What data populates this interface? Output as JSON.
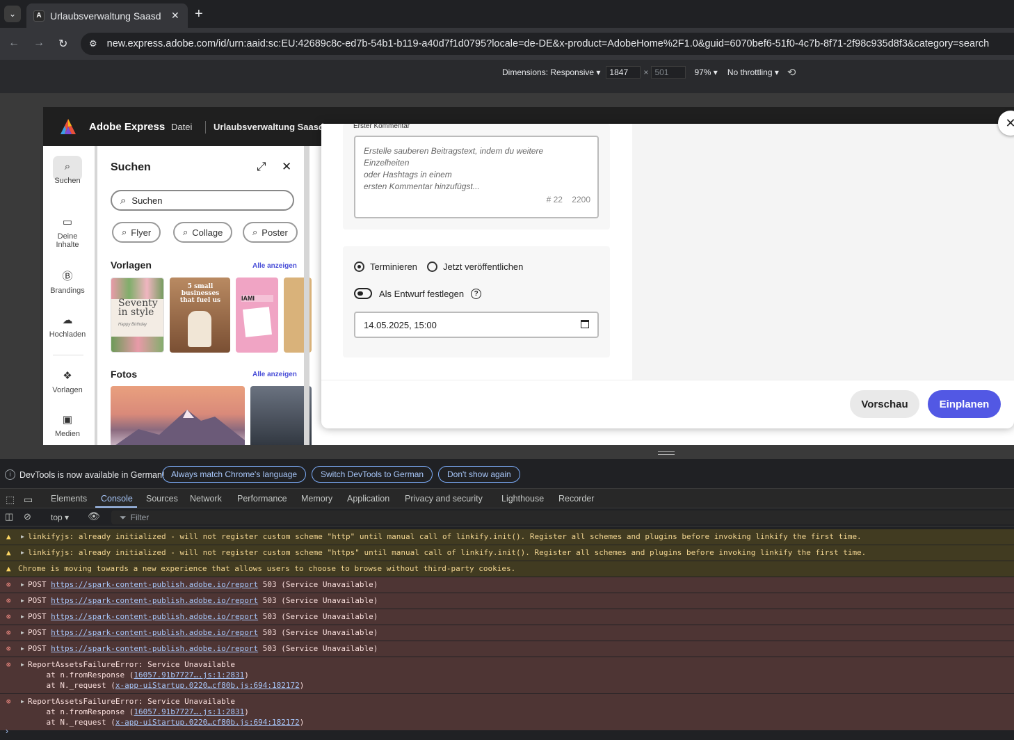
{
  "browser": {
    "tab_title": "Urlaubsverwaltung Saasd",
    "url": "new.express.adobe.com/id/urn:aaid:sc:EU:42689c8c-ed7b-54b1-b119-a40d7f1d0795?locale=de-DE&x-product=AdobeHome%2F1.0&guid=6070bef6-51f0-4c7b-8f71-2f98c935d8f3&category=search"
  },
  "device_toolbar": {
    "dimensions_label": "Dimensions: Responsive",
    "width": "1847",
    "times": "×",
    "height": "501",
    "zoom": "97%",
    "throttling": "No throttling"
  },
  "app": {
    "brand": "Adobe Express",
    "menu_file": "Datei",
    "doc_title": "Urlaubsverwaltung Saasde",
    "rail": [
      {
        "label": "Suchen",
        "icon": "search-icon"
      },
      {
        "label": "Deine Inhalte",
        "icon": "folder-icon"
      },
      {
        "label": "Brandings",
        "icon": "brand-icon"
      },
      {
        "label": "Hochladen",
        "icon": "upload-icon"
      },
      {
        "label": "Vorlagen",
        "icon": "templates-icon"
      },
      {
        "label": "Medien",
        "icon": "media-icon"
      }
    ],
    "panel": {
      "title": "Suchen",
      "search_placeholder": "Suchen",
      "chips": [
        "Flyer",
        "Collage",
        "Poster"
      ],
      "templates_title": "Vorlagen",
      "see_all": "Alle anzeigen",
      "photos_title": "Fotos",
      "template_texts": [
        "Seventy in style",
        "Happy Birthday",
        "5 small businesses that fuel us",
        "IAMI"
      ]
    }
  },
  "modal": {
    "comment_label": "Erster Kommentar",
    "comment_placeholder_1": "Erstelle sauberen Beitragstext, indem du weitere Einzelheiten",
    "comment_placeholder_2": "oder Hashtags in einem",
    "comment_placeholder_3": "ersten Kommentar hinzufügst...",
    "hashtag_count": "# 22",
    "char_count": "2200",
    "radio_schedule": "Terminieren",
    "radio_publish_now": "Jetzt veröffentlichen",
    "draft_label": "Als Entwurf festlegen",
    "date_value": "14.05.2025, 15:00",
    "btn_preview": "Vorschau",
    "btn_schedule": "Einplanen"
  },
  "devtools": {
    "lang_message": "DevTools is now available in German!",
    "btn_match": "Always match Chrome's language",
    "btn_switch": "Switch DevTools to German",
    "btn_dont_show": "Don't show again",
    "tabs": [
      "Elements",
      "Console",
      "Sources",
      "Network",
      "Performance",
      "Memory",
      "Application",
      "Privacy and security",
      "Lighthouse",
      "Recorder"
    ],
    "context": "top",
    "filter_placeholder": "Filter",
    "messages": [
      {
        "level": "warn",
        "text": "linkifyjs: already initialized - will not register custom scheme \"http\" until manual call of linkify.init(). Register all schemes and plugins before invoking linkify the first time."
      },
      {
        "level": "warn",
        "text": "linkifyjs: already initialized - will not register custom scheme \"https\" until manual call of linkify.init(). Register all schemes and plugins before invoking linkify the first time."
      },
      {
        "level": "warn",
        "text": "Chrome is moving towards a new experience that allows users to choose to browse without third-party cookies."
      },
      {
        "level": "err",
        "prefix": "POST ",
        "link": "https://spark-content-publish.adobe.io/report",
        "suffix": " 503 (Service Unavailable)"
      },
      {
        "level": "err",
        "prefix": "POST ",
        "link": "https://spark-content-publish.adobe.io/report",
        "suffix": " 503 (Service Unavailable)"
      },
      {
        "level": "err",
        "prefix": "POST ",
        "link": "https://spark-content-publish.adobe.io/report",
        "suffix": " 503 (Service Unavailable)"
      },
      {
        "level": "err",
        "prefix": "POST ",
        "link": "https://spark-content-publish.adobe.io/report",
        "suffix": " 503 (Service Unavailable)"
      },
      {
        "level": "err",
        "prefix": "POST ",
        "link": "https://spark-content-publish.adobe.io/report",
        "suffix": " 503 (Service Unavailable)"
      },
      {
        "level": "err",
        "text": "ReportAssetsFailureError: Service Unavailable",
        "stack1_pre": "    at n.fromResponse (",
        "stack1_link": "16057.91b7727….js:1:2831",
        "stack2_pre": "    at N._request (",
        "stack2_link": "x-app-uiStartup.0220…cf80b.js:694:182172"
      },
      {
        "level": "err",
        "text": "ReportAssetsFailureError: Service Unavailable",
        "stack1_pre": "    at n.fromResponse (",
        "stack1_link": "16057.91b7727….js:1:2831",
        "stack2_pre": "    at N._request (",
        "stack2_link": "x-app-uiStartup.0220…cf80b.js:694:182172"
      }
    ]
  },
  "colors": {
    "accent": "#5258e4",
    "warn_bg": "#413b21",
    "error_bg": "#4e3534"
  }
}
